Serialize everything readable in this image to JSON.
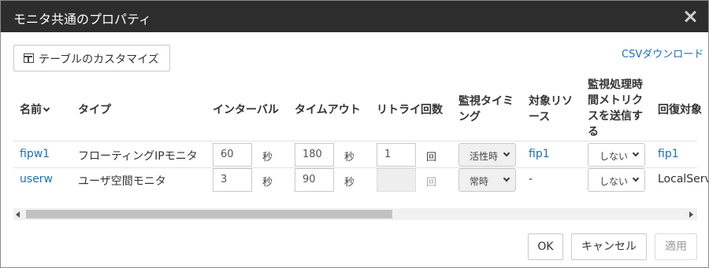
{
  "dialog": {
    "title": "モニタ共通のプロパティ",
    "close_icon": "close-icon"
  },
  "toolbar": {
    "customize_label": "テーブルのカスタマイズ",
    "customize_icon": "table-icon",
    "csv_label": "CSVダウンロード"
  },
  "table": {
    "headers": {
      "name": "名前",
      "type": "タイプ",
      "interval": "インターバル",
      "timeout": "タイムアウト",
      "retry": "リトライ回数",
      "timing_line1": "監視タイミ",
      "timing_line2": "ング",
      "target_line1": "対象リソ",
      "target_line2": "ース",
      "metrics_line1": "監視処理時",
      "metrics_line2": "間メトリク",
      "metrics_line3": "スを送信す",
      "metrics_line4": "る",
      "recovery": "回復対象"
    },
    "rows": [
      {
        "name": "fipw1",
        "type": "フローティングIPモニタ",
        "interval": "60",
        "interval_unit": "秒",
        "timeout": "180",
        "timeout_unit": "秒",
        "retry": "1",
        "retry_unit": "回",
        "timing": "活性時",
        "target": "fip1",
        "metrics": "しない",
        "recovery": "fip1"
      },
      {
        "name": "userw",
        "type": "ユーザ空間モニタ",
        "interval": "3",
        "interval_unit": "秒",
        "timeout": "90",
        "timeout_unit": "秒",
        "retry": "",
        "retry_unit": "回",
        "timing": "常時",
        "target": "-",
        "metrics": "しない",
        "recovery": "LocalServer"
      }
    ]
  },
  "scrollbar": {
    "horizontal_position": 0.0
  },
  "footer": {
    "ok_label": "OK",
    "cancel_label": "キャンセル",
    "apply_label": "適用"
  },
  "colors": {
    "titlebar": "#2d2d2d",
    "link": "#1d6fb8"
  }
}
